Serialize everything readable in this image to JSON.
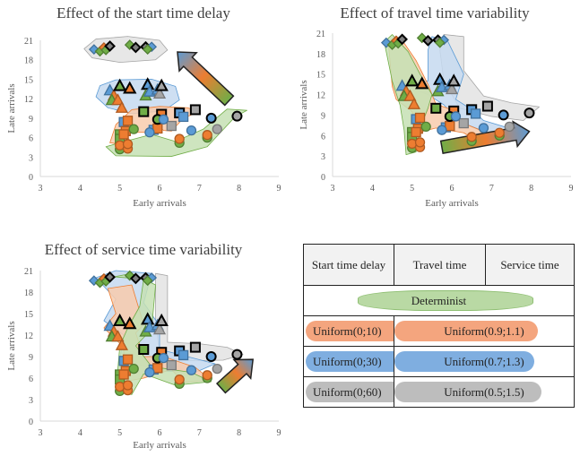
{
  "colors": {
    "determinist": "#70ad47",
    "level1": "#ed7d31",
    "level2": "#5b9bd5",
    "level3": "#a5a5a5"
  },
  "chart_data": [
    {
      "type": "scatter",
      "title": "Effect of the start time delay",
      "xlabel": "Early arrivals",
      "ylabel": "Late arrivals",
      "xlim": [
        3,
        9
      ],
      "ylim": [
        0,
        21
      ],
      "xticks": [
        3,
        4,
        5,
        6,
        7,
        8,
        9
      ],
      "yticks": [
        0,
        3,
        6,
        9,
        12,
        15,
        18,
        21
      ],
      "grid": false,
      "annotation": "gradient arrow pointing up-left"
    },
    {
      "type": "scatter",
      "title": "Effect of travel time variability",
      "xlabel": "Early arrivals",
      "ylabel": "Late arrivals",
      "xlim": [
        3,
        9
      ],
      "ylim": [
        0,
        21
      ],
      "xticks": [
        3,
        4,
        5,
        6,
        7,
        8,
        9
      ],
      "yticks": [
        0,
        3,
        6,
        9,
        12,
        15,
        18,
        21
      ],
      "grid": false,
      "annotation": "gradient arrow pointing right"
    },
    {
      "type": "scatter",
      "title": "Effect of service time variability",
      "xlabel": "Early arrivals",
      "ylabel": "Late arrivals",
      "xlim": [
        3,
        9
      ],
      "ylim": [
        0,
        21
      ],
      "xticks": [
        3,
        4,
        5,
        6,
        7,
        8,
        9
      ],
      "yticks": [
        0,
        3,
        6,
        9,
        12,
        15,
        18,
        21
      ],
      "grid": false,
      "annotation": "gradient arrow pointing up-right"
    }
  ],
  "points": [
    {
      "s": "diamond",
      "c": "blue",
      "x": 4.35,
      "y": 19.6
    },
    {
      "s": "diamond",
      "c": "green",
      "x": 4.5,
      "y": 19.3
    },
    {
      "s": "diamond",
      "c": "orange",
      "x": 4.6,
      "y": 19.9
    },
    {
      "s": "diamond",
      "c": "green",
      "x": 4.65,
      "y": 19.5
    },
    {
      "s": "diamond",
      "c": "black",
      "x": 4.75,
      "y": 20.1
    },
    {
      "s": "diamond",
      "c": "green",
      "x": 5.25,
      "y": 20.3
    },
    {
      "s": "diamond",
      "c": "black",
      "x": 5.4,
      "y": 19.9
    },
    {
      "s": "diamond",
      "c": "black",
      "x": 5.65,
      "y": 20
    },
    {
      "s": "diamond",
      "c": "blue",
      "x": 5.8,
      "y": 20
    },
    {
      "s": "diamond",
      "c": "green",
      "x": 5.7,
      "y": 19.6
    },
    {
      "s": "triangle",
      "c": "blue",
      "x": 4.75,
      "y": 13.3
    },
    {
      "s": "triangle",
      "c": "orange",
      "x": 4.85,
      "y": 12.5
    },
    {
      "s": "triangle",
      "c": "green",
      "x": 4.8,
      "y": 11.8
    },
    {
      "s": "triangle",
      "c": "orange",
      "x": 4.95,
      "y": 11.8
    },
    {
      "s": "triangle",
      "c": "orange",
      "x": 5.05,
      "y": 10.6
    },
    {
      "s": "triangle",
      "c": "black",
      "fill": "green",
      "x": 5.0,
      "y": 14
    },
    {
      "s": "triangle",
      "c": "black",
      "fill": "orange",
      "x": 5.25,
      "y": 13.6
    },
    {
      "s": "triangle",
      "c": "black",
      "fill": "blue",
      "x": 5.7,
      "y": 14.2
    },
    {
      "s": "triangle",
      "c": "green",
      "x": 5.65,
      "y": 12.5
    },
    {
      "s": "triangle",
      "c": "blue",
      "x": 5.75,
      "y": 13.1
    },
    {
      "s": "triangle",
      "c": "blue",
      "x": 5.95,
      "y": 13.4
    },
    {
      "s": "triangle",
      "c": "gray",
      "x": 6.0,
      "y": 12.8
    },
    {
      "s": "triangle",
      "c": "black",
      "fill": "gray",
      "x": 6.05,
      "y": 14
    },
    {
      "s": "square",
      "c": "green",
      "x": 5.0,
      "y": 6.5
    },
    {
      "s": "square",
      "c": "green",
      "x": 5.0,
      "y": 5.8
    },
    {
      "s": "square",
      "c": "blue",
      "x": 5.1,
      "y": 8.4
    },
    {
      "s": "square",
      "c": "orange",
      "x": 5.2,
      "y": 8.6
    },
    {
      "s": "square",
      "c": "orange",
      "x": 5.15,
      "y": 7
    },
    {
      "s": "square",
      "c": "orange",
      "x": 5.1,
      "y": 6.5
    },
    {
      "s": "square",
      "c": "black",
      "fill": "green",
      "x": 5.6,
      "y": 10
    },
    {
      "s": "square",
      "c": "black",
      "fill": "orange",
      "x": 6.05,
      "y": 9.6
    },
    {
      "s": "square",
      "c": "blue",
      "x": 5.85,
      "y": 7.2
    },
    {
      "s": "square",
      "c": "orange",
      "x": 5.95,
      "y": 7.4
    },
    {
      "s": "square",
      "c": "gray",
      "x": 6.3,
      "y": 7.8
    },
    {
      "s": "square",
      "c": "black",
      "fill": "blue",
      "x": 6.5,
      "y": 9.8
    },
    {
      "s": "square",
      "c": "blue",
      "x": 6.6,
      "y": 9.2
    },
    {
      "s": "square",
      "c": "black",
      "fill": "gray",
      "x": 6.9,
      "y": 10.3
    },
    {
      "s": "circle",
      "c": "green",
      "x": 5.0,
      "y": 4.2
    },
    {
      "s": "circle",
      "c": "orange",
      "x": 5.0,
      "y": 4.8
    },
    {
      "s": "circle",
      "c": "orange",
      "x": 5.2,
      "y": 4.3
    },
    {
      "s": "circle",
      "c": "orange",
      "x": 5.2,
      "y": 5
    },
    {
      "s": "circle",
      "c": "green",
      "x": 5.35,
      "y": 7.3
    },
    {
      "s": "circle",
      "c": "blue",
      "x": 5.75,
      "y": 6.8
    },
    {
      "s": "circle",
      "c": "black",
      "fill": "green",
      "x": 5.95,
      "y": 8.8
    },
    {
      "s": "circle",
      "c": "blue",
      "x": 6.1,
      "y": 8.8
    },
    {
      "s": "circle",
      "c": "green",
      "x": 6.5,
      "y": 5.2
    },
    {
      "s": "circle",
      "c": "orange",
      "x": 6.5,
      "y": 5.8
    },
    {
      "s": "circle",
      "c": "blue",
      "x": 6.8,
      "y": 7.1
    },
    {
      "s": "circle",
      "c": "green",
      "x": 7.2,
      "y": 6
    },
    {
      "s": "circle",
      "c": "orange",
      "x": 7.2,
      "y": 6.4
    },
    {
      "s": "circle",
      "c": "black",
      "fill": "blue",
      "x": 7.3,
      "y": 9
    },
    {
      "s": "circle",
      "c": "gray",
      "x": 7.45,
      "y": 7.3
    },
    {
      "s": "circle",
      "c": "black",
      "fill": "gray",
      "x": 7.95,
      "y": 9.3
    }
  ],
  "legend_table": {
    "headers": [
      "Start time delay",
      "Travel time",
      "Service time"
    ],
    "determinist": "Determinist",
    "rows": [
      {
        "start": "Uniform(0;10)",
        "travel_service": "Uniform(0.9;1.1)"
      },
      {
        "start": "Uniform(0;30)",
        "travel_service": "Uniform(0.7;1.3)"
      },
      {
        "start": "Uniform(0;60)",
        "travel_service": "Uniform(0.5;1.5)"
      }
    ]
  }
}
